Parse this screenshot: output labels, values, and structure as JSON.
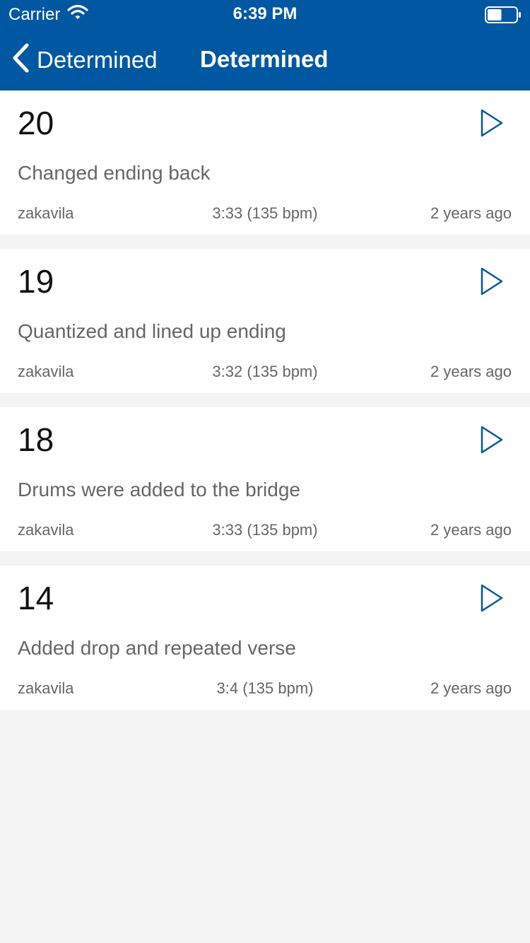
{
  "status_bar": {
    "carrier": "Carrier",
    "time": "6:39 PM",
    "battery_level": 0.5
  },
  "nav": {
    "back_label": "Determined",
    "title": "Determined"
  },
  "colors": {
    "brand": "#0058a3",
    "play_icon": "#0058a3",
    "background": "#f4f4f4",
    "card": "#ffffff",
    "secondary_text": "#666666"
  },
  "versions": [
    {
      "number": "20",
      "description": "Changed ending back",
      "user": "zakavila",
      "duration": "3:33 (135 bpm)",
      "age": "2 years ago",
      "play_icon": "play-icon"
    },
    {
      "number": "19",
      "description": "Quantized and lined up ending",
      "user": "zakavila",
      "duration": "3:32 (135 bpm)",
      "age": "2 years ago",
      "play_icon": "play-icon"
    },
    {
      "number": "18",
      "description": "Drums were added to the bridge",
      "user": "zakavila",
      "duration": "3:33 (135 bpm)",
      "age": "2 years ago",
      "play_icon": "play-icon"
    },
    {
      "number": "14",
      "description": "Added drop and repeated verse",
      "user": "zakavila",
      "duration": "3:4 (135 bpm)",
      "age": "2 years ago",
      "play_icon": "play-icon"
    }
  ]
}
